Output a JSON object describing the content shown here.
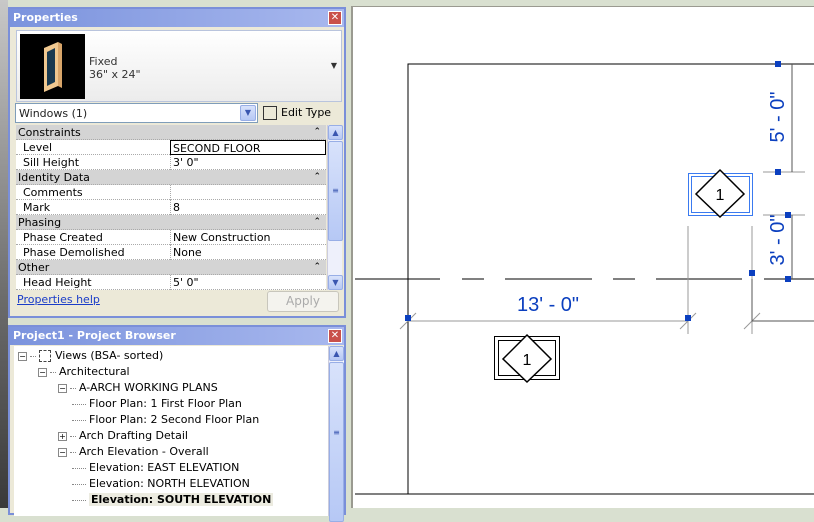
{
  "properties": {
    "title": "Properties",
    "type_name": "Fixed",
    "type_size": "36\" x 24\"",
    "filter": "Windows (1)",
    "edit_type": "Edit Type",
    "groups": [
      {
        "name": "Constraints",
        "rows": [
          {
            "k": "Level",
            "v": "SECOND FLOOR"
          },
          {
            "k": "Sill Height",
            "v": "3'  0\""
          }
        ]
      },
      {
        "name": "Identity Data",
        "rows": [
          {
            "k": "Comments",
            "v": ""
          },
          {
            "k": "Mark",
            "v": "8"
          }
        ]
      },
      {
        "name": "Phasing",
        "rows": [
          {
            "k": "Phase Created",
            "v": "New Construction"
          },
          {
            "k": "Phase Demolished",
            "v": "None"
          }
        ]
      },
      {
        "name": "Other",
        "rows": [
          {
            "k": "Head Height",
            "v": "5'  0\""
          }
        ]
      }
    ],
    "help": "Properties help",
    "apply": "Apply"
  },
  "browser": {
    "title": "Project1 - Project Browser",
    "items": [
      {
        "label": "Views (BSA- sorted)",
        "level": 0,
        "toggle": "-"
      },
      {
        "label": "Architectural",
        "level": 1,
        "toggle": "-"
      },
      {
        "label": "A-ARCH WORKING PLANS",
        "level": 2,
        "toggle": "-"
      },
      {
        "label": "Floor Plan: 1 First Floor Plan",
        "level": 3
      },
      {
        "label": "Floor Plan: 2 Second Floor Plan",
        "level": 3
      },
      {
        "label": "Arch Drafting Detail",
        "level": 2,
        "toggle": "+"
      },
      {
        "label": "Arch Elevation - Overall",
        "level": 2,
        "toggle": "-"
      },
      {
        "label": "Elevation: EAST ELEVATION",
        "level": 3
      },
      {
        "label": "Elevation: NORTH ELEVATION",
        "level": 3
      },
      {
        "label": "Elevation: SOUTH ELEVATION",
        "level": 3,
        "selected": true
      }
    ]
  },
  "canvas": {
    "dim_horizontal": "13' - 0\"",
    "dim_upper": "5' - 0\"",
    "dim_lower": "3' - 0\"",
    "tag_selected": "1",
    "tag_other": "1"
  },
  "colors": {
    "accent": "#0b3fbf",
    "select": "#3a7af0"
  }
}
